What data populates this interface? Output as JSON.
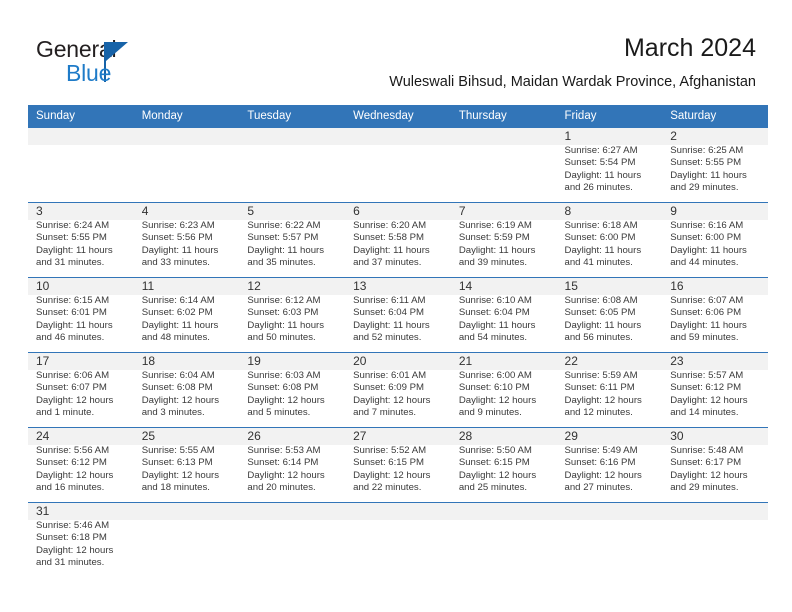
{
  "brand": {
    "name_top": "General",
    "name_bottom": "Blue",
    "color_dark": "#231f20",
    "color_blue": "#1e7bc8"
  },
  "header": {
    "title": "March 2024",
    "subtitle": "Wuleswali Bihsud, Maidan Wardak Province, Afghanistan"
  },
  "theme": {
    "header_blue": "#3275b8",
    "day_band_gray": "#f2f2f2",
    "row_rule": "#3275b8"
  },
  "weekday_headers": [
    "Sunday",
    "Monday",
    "Tuesday",
    "Wednesday",
    "Thursday",
    "Friday",
    "Saturday"
  ],
  "weeks": [
    [
      {
        "day": "",
        "sunrise": "",
        "sunset": "",
        "daylight1": "",
        "daylight2": ""
      },
      {
        "day": "",
        "sunrise": "",
        "sunset": "",
        "daylight1": "",
        "daylight2": ""
      },
      {
        "day": "",
        "sunrise": "",
        "sunset": "",
        "daylight1": "",
        "daylight2": ""
      },
      {
        "day": "",
        "sunrise": "",
        "sunset": "",
        "daylight1": "",
        "daylight2": ""
      },
      {
        "day": "",
        "sunrise": "",
        "sunset": "",
        "daylight1": "",
        "daylight2": ""
      },
      {
        "day": "1",
        "sunrise": "Sunrise: 6:27 AM",
        "sunset": "Sunset: 5:54 PM",
        "daylight1": "Daylight: 11 hours",
        "daylight2": "and 26 minutes."
      },
      {
        "day": "2",
        "sunrise": "Sunrise: 6:25 AM",
        "sunset": "Sunset: 5:55 PM",
        "daylight1": "Daylight: 11 hours",
        "daylight2": "and 29 minutes."
      }
    ],
    [
      {
        "day": "3",
        "sunrise": "Sunrise: 6:24 AM",
        "sunset": "Sunset: 5:55 PM",
        "daylight1": "Daylight: 11 hours",
        "daylight2": "and 31 minutes."
      },
      {
        "day": "4",
        "sunrise": "Sunrise: 6:23 AM",
        "sunset": "Sunset: 5:56 PM",
        "daylight1": "Daylight: 11 hours",
        "daylight2": "and 33 minutes."
      },
      {
        "day": "5",
        "sunrise": "Sunrise: 6:22 AM",
        "sunset": "Sunset: 5:57 PM",
        "daylight1": "Daylight: 11 hours",
        "daylight2": "and 35 minutes."
      },
      {
        "day": "6",
        "sunrise": "Sunrise: 6:20 AM",
        "sunset": "Sunset: 5:58 PM",
        "daylight1": "Daylight: 11 hours",
        "daylight2": "and 37 minutes."
      },
      {
        "day": "7",
        "sunrise": "Sunrise: 6:19 AM",
        "sunset": "Sunset: 5:59 PM",
        "daylight1": "Daylight: 11 hours",
        "daylight2": "and 39 minutes."
      },
      {
        "day": "8",
        "sunrise": "Sunrise: 6:18 AM",
        "sunset": "Sunset: 6:00 PM",
        "daylight1": "Daylight: 11 hours",
        "daylight2": "and 41 minutes."
      },
      {
        "day": "9",
        "sunrise": "Sunrise: 6:16 AM",
        "sunset": "Sunset: 6:00 PM",
        "daylight1": "Daylight: 11 hours",
        "daylight2": "and 44 minutes."
      }
    ],
    [
      {
        "day": "10",
        "sunrise": "Sunrise: 6:15 AM",
        "sunset": "Sunset: 6:01 PM",
        "daylight1": "Daylight: 11 hours",
        "daylight2": "and 46 minutes."
      },
      {
        "day": "11",
        "sunrise": "Sunrise: 6:14 AM",
        "sunset": "Sunset: 6:02 PM",
        "daylight1": "Daylight: 11 hours",
        "daylight2": "and 48 minutes."
      },
      {
        "day": "12",
        "sunrise": "Sunrise: 6:12 AM",
        "sunset": "Sunset: 6:03 PM",
        "daylight1": "Daylight: 11 hours",
        "daylight2": "and 50 minutes."
      },
      {
        "day": "13",
        "sunrise": "Sunrise: 6:11 AM",
        "sunset": "Sunset: 6:04 PM",
        "daylight1": "Daylight: 11 hours",
        "daylight2": "and 52 minutes."
      },
      {
        "day": "14",
        "sunrise": "Sunrise: 6:10 AM",
        "sunset": "Sunset: 6:04 PM",
        "daylight1": "Daylight: 11 hours",
        "daylight2": "and 54 minutes."
      },
      {
        "day": "15",
        "sunrise": "Sunrise: 6:08 AM",
        "sunset": "Sunset: 6:05 PM",
        "daylight1": "Daylight: 11 hours",
        "daylight2": "and 56 minutes."
      },
      {
        "day": "16",
        "sunrise": "Sunrise: 6:07 AM",
        "sunset": "Sunset: 6:06 PM",
        "daylight1": "Daylight: 11 hours",
        "daylight2": "and 59 minutes."
      }
    ],
    [
      {
        "day": "17",
        "sunrise": "Sunrise: 6:06 AM",
        "sunset": "Sunset: 6:07 PM",
        "daylight1": "Daylight: 12 hours",
        "daylight2": "and 1 minute."
      },
      {
        "day": "18",
        "sunrise": "Sunrise: 6:04 AM",
        "sunset": "Sunset: 6:08 PM",
        "daylight1": "Daylight: 12 hours",
        "daylight2": "and 3 minutes."
      },
      {
        "day": "19",
        "sunrise": "Sunrise: 6:03 AM",
        "sunset": "Sunset: 6:08 PM",
        "daylight1": "Daylight: 12 hours",
        "daylight2": "and 5 minutes."
      },
      {
        "day": "20",
        "sunrise": "Sunrise: 6:01 AM",
        "sunset": "Sunset: 6:09 PM",
        "daylight1": "Daylight: 12 hours",
        "daylight2": "and 7 minutes."
      },
      {
        "day": "21",
        "sunrise": "Sunrise: 6:00 AM",
        "sunset": "Sunset: 6:10 PM",
        "daylight1": "Daylight: 12 hours",
        "daylight2": "and 9 minutes."
      },
      {
        "day": "22",
        "sunrise": "Sunrise: 5:59 AM",
        "sunset": "Sunset: 6:11 PM",
        "daylight1": "Daylight: 12 hours",
        "daylight2": "and 12 minutes."
      },
      {
        "day": "23",
        "sunrise": "Sunrise: 5:57 AM",
        "sunset": "Sunset: 6:12 PM",
        "daylight1": "Daylight: 12 hours",
        "daylight2": "and 14 minutes."
      }
    ],
    [
      {
        "day": "24",
        "sunrise": "Sunrise: 5:56 AM",
        "sunset": "Sunset: 6:12 PM",
        "daylight1": "Daylight: 12 hours",
        "daylight2": "and 16 minutes."
      },
      {
        "day": "25",
        "sunrise": "Sunrise: 5:55 AM",
        "sunset": "Sunset: 6:13 PM",
        "daylight1": "Daylight: 12 hours",
        "daylight2": "and 18 minutes."
      },
      {
        "day": "26",
        "sunrise": "Sunrise: 5:53 AM",
        "sunset": "Sunset: 6:14 PM",
        "daylight1": "Daylight: 12 hours",
        "daylight2": "and 20 minutes."
      },
      {
        "day": "27",
        "sunrise": "Sunrise: 5:52 AM",
        "sunset": "Sunset: 6:15 PM",
        "daylight1": "Daylight: 12 hours",
        "daylight2": "and 22 minutes."
      },
      {
        "day": "28",
        "sunrise": "Sunrise: 5:50 AM",
        "sunset": "Sunset: 6:15 PM",
        "daylight1": "Daylight: 12 hours",
        "daylight2": "and 25 minutes."
      },
      {
        "day": "29",
        "sunrise": "Sunrise: 5:49 AM",
        "sunset": "Sunset: 6:16 PM",
        "daylight1": "Daylight: 12 hours",
        "daylight2": "and 27 minutes."
      },
      {
        "day": "30",
        "sunrise": "Sunrise: 5:48 AM",
        "sunset": "Sunset: 6:17 PM",
        "daylight1": "Daylight: 12 hours",
        "daylight2": "and 29 minutes."
      }
    ],
    [
      {
        "day": "31",
        "sunrise": "Sunrise: 5:46 AM",
        "sunset": "Sunset: 6:18 PM",
        "daylight1": "Daylight: 12 hours",
        "daylight2": "and 31 minutes."
      },
      {
        "day": "",
        "sunrise": "",
        "sunset": "",
        "daylight1": "",
        "daylight2": ""
      },
      {
        "day": "",
        "sunrise": "",
        "sunset": "",
        "daylight1": "",
        "daylight2": ""
      },
      {
        "day": "",
        "sunrise": "",
        "sunset": "",
        "daylight1": "",
        "daylight2": ""
      },
      {
        "day": "",
        "sunrise": "",
        "sunset": "",
        "daylight1": "",
        "daylight2": ""
      },
      {
        "day": "",
        "sunrise": "",
        "sunset": "",
        "daylight1": "",
        "daylight2": ""
      },
      {
        "day": "",
        "sunrise": "",
        "sunset": "",
        "daylight1": "",
        "daylight2": ""
      }
    ]
  ]
}
